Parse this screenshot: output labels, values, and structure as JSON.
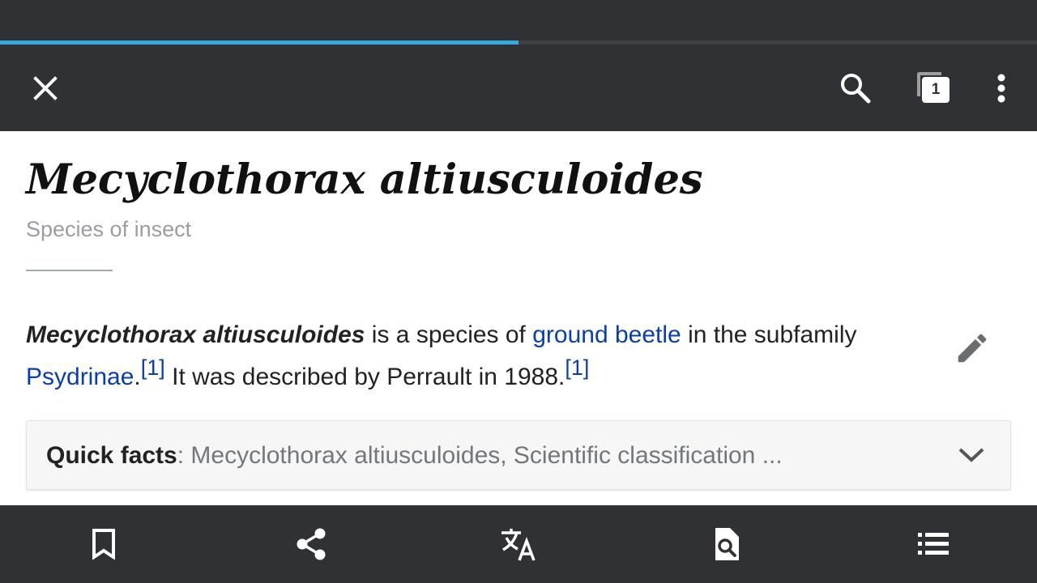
{
  "page_load_progress": 0.5,
  "toolbar": {
    "tab_count": "1",
    "close_icon": "close-icon",
    "search_icon": "search-icon",
    "tabs_icon": "tabs-icon",
    "more_icon": "more-vert-icon"
  },
  "article": {
    "title": "Mecyclothorax altiusculoides",
    "description": "Species of insect",
    "paragraph": {
      "bold_term": "Mecyclothorax altiusculoides",
      "text_1": " is a species of ",
      "link_1": "ground beetle",
      "text_2": " in the subfamily ",
      "link_2": "Psydrinae",
      "text_3": ".",
      "ref_1": "[1]",
      "text_4": " It was described by Perrault in 1988.",
      "ref_2": "[1]"
    },
    "edit_icon": "pencil-icon",
    "quick_facts": {
      "label": "Quick facts",
      "colon": ": ",
      "summary": "Mecyclothorax altiusculoides, Scientific classification ...",
      "chevron_icon": "chevron-down-icon"
    }
  },
  "bottom_bar": {
    "items": [
      {
        "icon": "bookmark-icon"
      },
      {
        "icon": "share-icon"
      },
      {
        "icon": "translate-icon"
      },
      {
        "icon": "find-in-page-icon"
      },
      {
        "icon": "table-of-contents-icon"
      }
    ]
  },
  "colors": {
    "chrome_bg": "#303134",
    "progress": "#36a9e1",
    "link": "#0b3ea8",
    "muted_text": "#9a9da2"
  }
}
